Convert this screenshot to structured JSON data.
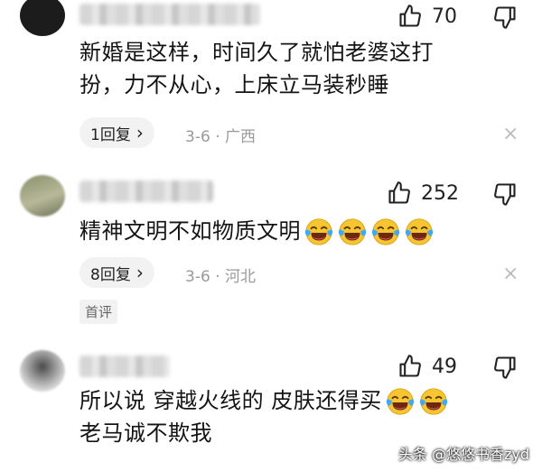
{
  "comments": [
    {
      "likes": "70",
      "text_lines": [
        "新婚是这样，时间久了就怕老婆这打",
        "扮，力不从心，上床立马装秒睡"
      ],
      "reply_label": "1回复",
      "date": "3-6",
      "location": "广西"
    },
    {
      "likes": "252",
      "text_lines": [
        "精神文明不如物质文明"
      ],
      "reply_label": "8回复",
      "date": "3-6",
      "location": "河北",
      "badge": "首评"
    },
    {
      "likes": "49",
      "text_lines": [
        "所以说 穿越火线的 皮肤还得买",
        "老马诚不欺我"
      ]
    }
  ],
  "separator": "·",
  "chevron": "›",
  "close_glyph": "×",
  "watermark": "头条 @悠悠书香zyd",
  "icons": {
    "like": "thumbs-up-icon",
    "dislike": "thumbs-down-icon",
    "emoji": "laughing-tears-emoji",
    "close": "close-icon"
  },
  "colors": {
    "meta_gray": "#9a9a9a",
    "pill_bg": "#f2f2f2",
    "emoji_yellow": "#f7c531",
    "emoji_tears": "#3fa9f5"
  }
}
